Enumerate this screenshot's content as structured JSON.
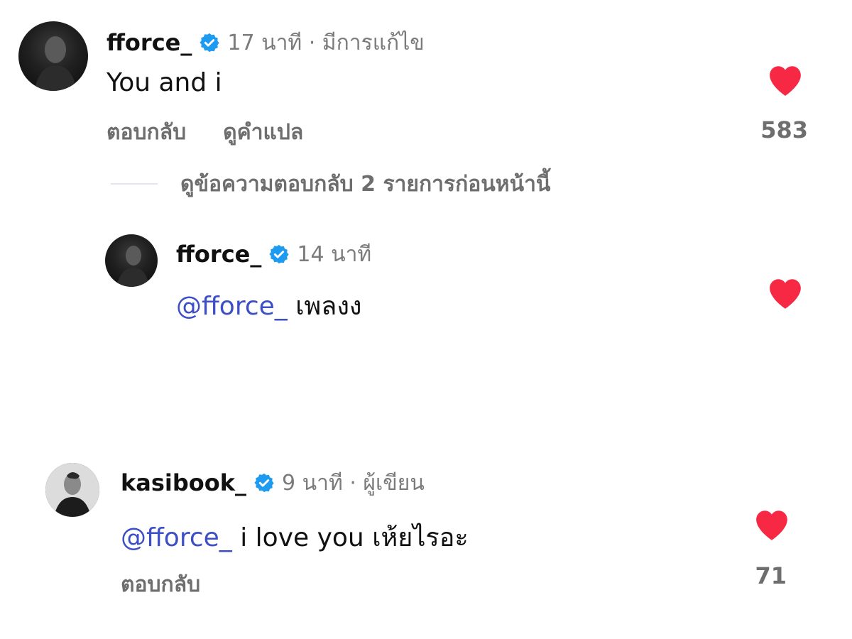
{
  "colors": {
    "heart": "#f72844",
    "verified": "#1d9bf0",
    "mention": "#3d4fc7",
    "secondary_text": "#6e6e6e"
  },
  "comments": [
    {
      "username": "fforce_",
      "verified": true,
      "time": "17 นาที · มีการแก้ไข",
      "text": "You and i",
      "reply_label": "ตอบกลับ",
      "translate_label": "ดูคำแปล",
      "likes": "583",
      "liked": true
    },
    {
      "view_replies_label": "ดูข้อความตอบกลับ 2 รายการก่อนหน้านี้"
    },
    {
      "username": "fforce_",
      "verified": true,
      "time": "14 นาที",
      "mention": "@fforce_",
      "text": "เพลงง",
      "liked": true
    },
    {
      "username": "kasibook_",
      "verified": true,
      "time": "9 นาที · ผู้เขียน",
      "mention": "@fforce_",
      "text": "i love you เห้ยไรอะ",
      "reply_label": "ตอบกลับ",
      "likes": "71",
      "liked": true
    }
  ],
  "icons": {
    "heart": "heart-filled-icon",
    "verified": "verified-badge-icon"
  }
}
